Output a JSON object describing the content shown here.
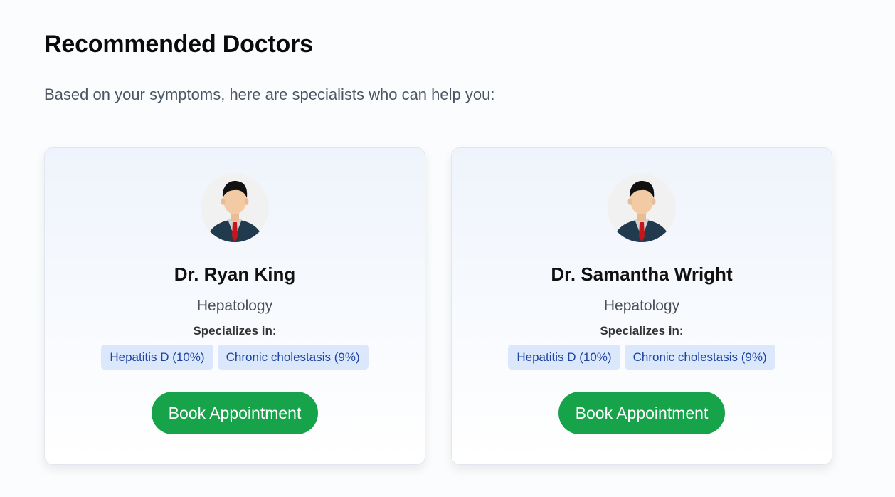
{
  "page": {
    "title": "Recommended Doctors",
    "subtitle": "Based on your symptoms, here are specialists who can help you:"
  },
  "doctors": [
    {
      "name": "Dr. Ryan King",
      "department": "Hepatology",
      "specializes_label": "Specializes in:",
      "tags": [
        "Hepatitis D (10%)",
        "Chronic cholestasis (9%)"
      ],
      "book_label": "Book Appointment",
      "avatar_icon": "doctor-avatar-icon"
    },
    {
      "name": "Dr. Samantha Wright",
      "department": "Hepatology",
      "specializes_label": "Specializes in:",
      "tags": [
        "Hepatitis D (10%)",
        "Chronic cholestasis (9%)"
      ],
      "book_label": "Book Appointment",
      "avatar_icon": "doctor-avatar-icon"
    }
  ],
  "colors": {
    "accent_green": "#17a34a",
    "tag_bg": "#dbe8fb",
    "tag_text": "#1e429f"
  }
}
